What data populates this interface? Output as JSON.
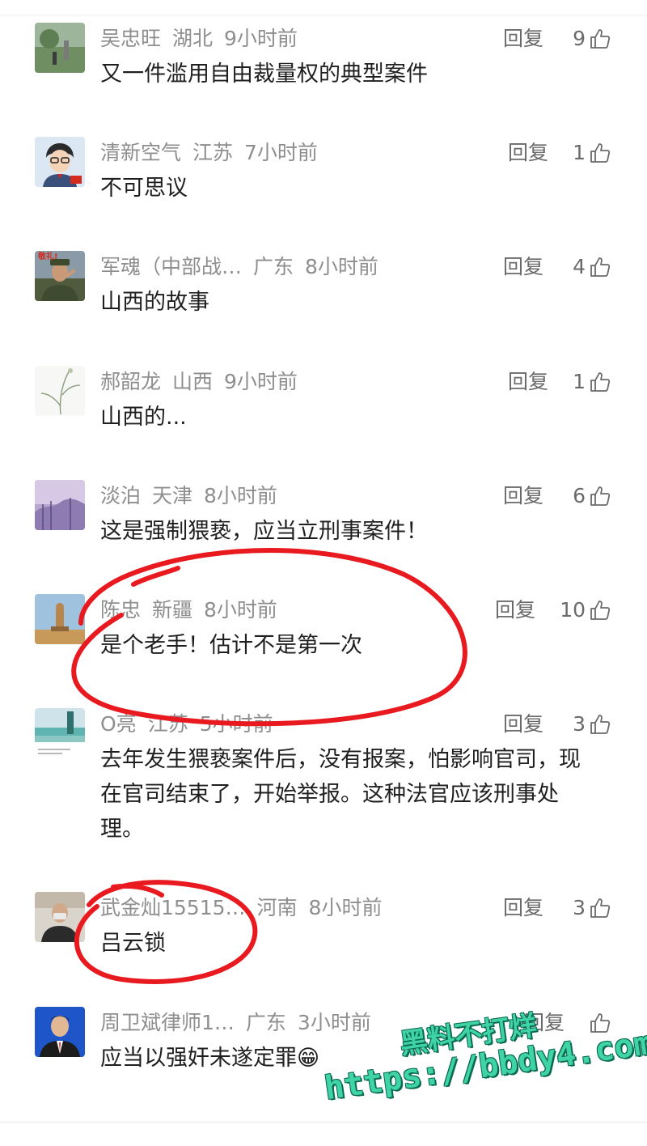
{
  "reply_label": "回复",
  "comments": [
    {
      "name": "吴忠旺",
      "region": "湖北",
      "time": "9小时前",
      "likes": "9",
      "text": "又一件滥用自由裁量权的典型案件"
    },
    {
      "name": "清新空气",
      "region": "江苏",
      "time": "7小时前",
      "likes": "1",
      "text": "不可思议"
    },
    {
      "name": "军魂（中部战…",
      "region": "广东",
      "time": "8小时前",
      "likes": "4",
      "text": "山西的故事",
      "avatar_caption": "敬礼!"
    },
    {
      "name": "郝韶龙",
      "region": "山西",
      "time": "9小时前",
      "likes": "1",
      "text": "山西的..."
    },
    {
      "name": "淡泊",
      "region": "天津",
      "time": "8小时前",
      "likes": "6",
      "text": "这是强制猥亵，应当立刑事案件！"
    },
    {
      "name": "陈忠",
      "region": "新疆",
      "time": "8小时前",
      "likes": "10",
      "text": "是个老手！估计不是第一次"
    },
    {
      "name": "O亮",
      "region": "江苏",
      "time": "5小时前",
      "likes": "3",
      "text": "去年发生猥亵案件后，没有报案，怕影响官司，现在官司结束了，开始举报。这种法官应该刑事处理。"
    },
    {
      "name": "武金灿15515…",
      "region": "河南",
      "time": "8小时前",
      "likes": "3",
      "text": "吕云锁"
    },
    {
      "name": "周卫斌律师1…",
      "region": "广东",
      "time": "3小时前",
      "likes": "",
      "text": "应当以强奸未遂定罪😁"
    }
  ],
  "watermark": {
    "line1": "黑料不打烊",
    "line2": "https://bbdy4.com"
  },
  "colors": {
    "annotation_red": "#e8191f",
    "watermark_green": "#3fd3a6",
    "meta_gray": "#8e8e8e"
  }
}
